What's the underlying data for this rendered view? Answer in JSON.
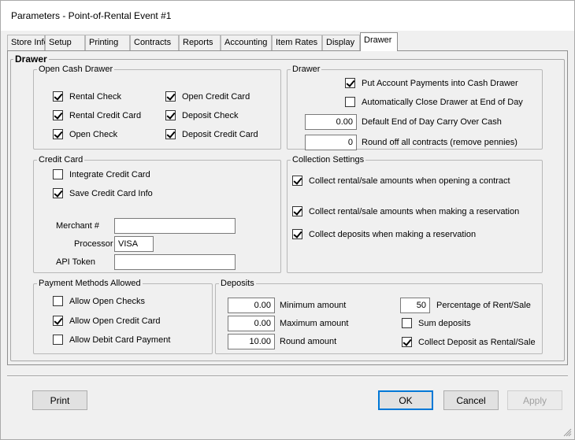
{
  "window": {
    "title": "Parameters - Point-of-Rental Event #1"
  },
  "tabs": [
    "Store Info",
    "Setup",
    "Printing",
    "Contracts",
    "Reports",
    "Accounting",
    "Item Rates",
    "Display",
    "Drawer"
  ],
  "active_tab": "Drawer",
  "drawer_group": {
    "legend": "Drawer"
  },
  "open_cash_drawer": {
    "legend": "Open Cash Drawer",
    "items": [
      {
        "label": "Rental Check",
        "checked": true
      },
      {
        "label": "Open Credit Card",
        "checked": true
      },
      {
        "label": "Rental Credit Card",
        "checked": true
      },
      {
        "label": "Deposit Check",
        "checked": true
      },
      {
        "label": "Open Check",
        "checked": true
      },
      {
        "label": "Deposit Credit Card",
        "checked": true
      }
    ]
  },
  "drawer": {
    "legend": "Drawer",
    "put_payments_label": "Put Account Payments into Cash Drawer",
    "put_payments_checked": true,
    "auto_close_label": "Automatically Close Drawer at End of Day",
    "auto_close_checked": false,
    "carry_over_value": "0.00",
    "carry_over_label": "Default End of Day Carry Over Cash",
    "round_off_value": "0",
    "round_off_label": "Round off all contracts (remove pennies)"
  },
  "credit_card": {
    "legend": "Credit Card",
    "integrate_label": "Integrate Credit Card",
    "integrate_checked": false,
    "save_info_label": "Save Credit Card Info",
    "save_info_checked": true,
    "merchant_label": "Merchant #",
    "merchant_value": "",
    "processor_label": "Processor",
    "processor_value": "VISA",
    "api_token_label": "API Token",
    "api_token_value": ""
  },
  "collection_settings": {
    "legend": "Collection Settings",
    "items": [
      {
        "label": "Collect rental/sale amounts when opening a contract",
        "checked": true
      },
      {
        "label": "Collect rental/sale amounts when making a reservation",
        "checked": true
      },
      {
        "label": "Collect deposits when making a reservation",
        "checked": true
      }
    ]
  },
  "payment_methods": {
    "legend": "Payment Methods Allowed",
    "items": [
      {
        "label": "Allow Open Checks",
        "checked": false
      },
      {
        "label": "Allow Open Credit Card",
        "checked": true
      },
      {
        "label": "Allow Debit Card Payment",
        "checked": false
      }
    ]
  },
  "deposits": {
    "legend": "Deposits",
    "minimum_value": "0.00",
    "minimum_label": "Minimum amount",
    "maximum_value": "0.00",
    "maximum_label": "Maximum amount",
    "round_value": "10.00",
    "round_label": "Round amount",
    "percentage_value": "50",
    "percentage_label": "Percentage of Rent/Sale",
    "sum_label": "Sum deposits",
    "sum_checked": false,
    "collect_as_rental_label": "Collect Deposit as Rental/Sale",
    "collect_as_rental_checked": true
  },
  "buttons": {
    "print": "Print",
    "ok": "OK",
    "cancel": "Cancel",
    "apply": "Apply"
  }
}
